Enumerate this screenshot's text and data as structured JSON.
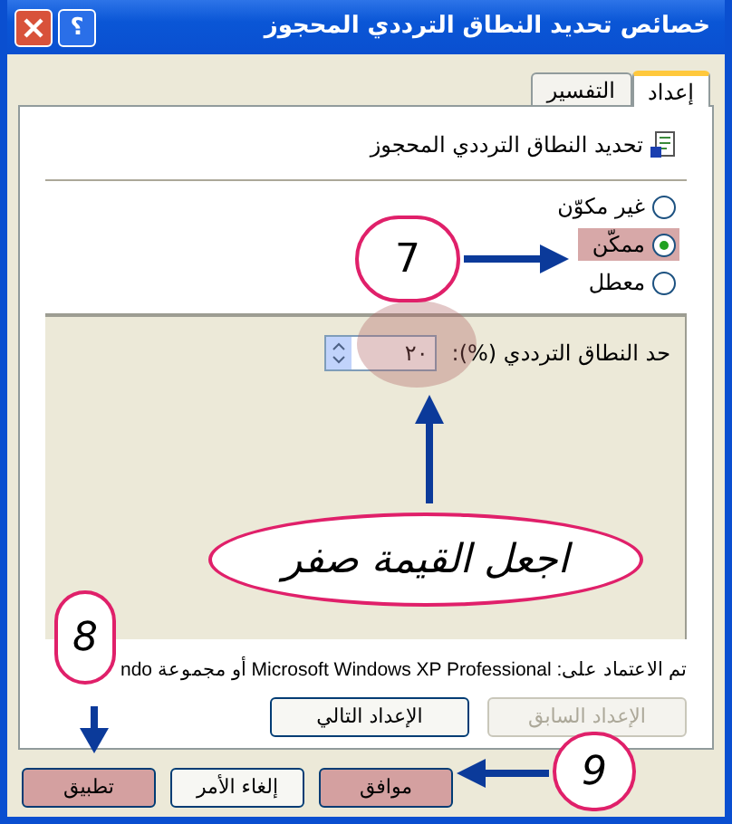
{
  "window": {
    "title": "خصائص تحديد النطاق الترددي المحجوز",
    "help": "؟"
  },
  "tabs": [
    {
      "label": "إعداد",
      "selected": true
    },
    {
      "label": "التفسير",
      "selected": false
    }
  ],
  "setting": {
    "title": "تحديد النطاق الترددي المحجوز"
  },
  "options": [
    {
      "label": "غير مكوّن",
      "selected": false,
      "highlighted": false
    },
    {
      "label": "ممكّن",
      "selected": true,
      "highlighted": true
    },
    {
      "label": "معطل",
      "selected": false,
      "highlighted": false
    }
  ],
  "field": {
    "label": "حد النطاق الترددي (%):",
    "value": "٢٠"
  },
  "supported": "تم الاعتماد على:  Microsoft Windows XP Professional أو مجموعة ndo",
  "nav_buttons": [
    {
      "label": "الإعداد السابق",
      "disabled": true
    },
    {
      "label": "الإعداد التالي",
      "disabled": false
    }
  ],
  "footer_buttons": [
    {
      "label": "موافق",
      "highlighted": true
    },
    {
      "label": "إلغاء الأمر",
      "highlighted": false
    },
    {
      "label": "تطبيق",
      "highlighted": true
    }
  ],
  "annotations": {
    "steps": [
      "7",
      "8",
      "9"
    ],
    "callout": "اجعل القيمة صفر"
  }
}
